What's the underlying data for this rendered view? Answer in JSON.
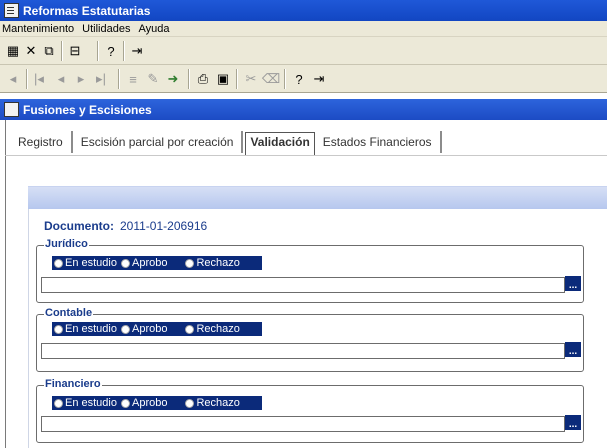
{
  "app": {
    "title": "Reformas Estatutarias"
  },
  "menu": [
    "Mantenimiento",
    "Utilidades",
    "Ayuda"
  ],
  "toolbar1": [
    "grid-icon",
    "excel-icon",
    "copy-icon",
    "print-preview-icon",
    "help-icon",
    "exit-icon"
  ],
  "toolbar2": [
    "back-icon",
    "first-icon",
    "previous-icon",
    "next-icon",
    "last-icon",
    "insert-row-icon",
    "edit-icon",
    "save-record-icon",
    "print-icon",
    "save-icon",
    "delete-icon",
    "clear-icon",
    "help-icon",
    "exit-icon"
  ],
  "subwindow": {
    "title": "Fusiones y Escisiones"
  },
  "tabs": [
    "Registro",
    "Escisión parcial por creación",
    "Validación",
    "Estados Financieros"
  ],
  "active_tab": "Validación",
  "document": {
    "label": "Documento:",
    "value": "2011-01-206916"
  },
  "groups": [
    {
      "title": "Jurídico",
      "options": [
        "En estudio",
        "Aprobo",
        "Rechazo"
      ],
      "value": ""
    },
    {
      "title": "Contable",
      "options": [
        "En estudio",
        "Aprobo",
        "Rechazo"
      ],
      "value": ""
    },
    {
      "title": "Financiero",
      "options": [
        "En estudio",
        "Aprobo",
        "Rechazo"
      ],
      "value": ""
    }
  ],
  "lookup_button": "..."
}
